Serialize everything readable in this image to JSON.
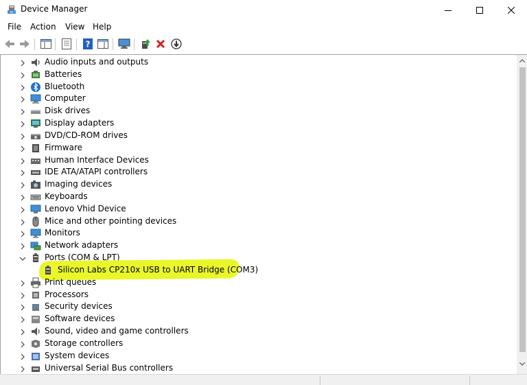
{
  "window": {
    "title": "Device Manager"
  },
  "menu": [
    "File",
    "Action",
    "View",
    "Help"
  ],
  "toolbar": [
    "back-icon",
    "forward-icon",
    "show-hide-console-tree-icon",
    "properties-icon",
    "help-icon",
    "action-pane-icon",
    "scan-hardware-changes-icon",
    "update-driver-icon",
    "uninstall-device-icon",
    "disable-device-icon"
  ],
  "tree": {
    "items": [
      {
        "label": "Audio inputs and outputs",
        "icon": "speaker-icon",
        "expanded": false
      },
      {
        "label": "Batteries",
        "icon": "battery-icon",
        "expanded": false
      },
      {
        "label": "Bluetooth",
        "icon": "bluetooth-icon",
        "expanded": false
      },
      {
        "label": "Computer",
        "icon": "computer-icon",
        "expanded": false
      },
      {
        "label": "Disk drives",
        "icon": "disk-drive-icon",
        "expanded": false
      },
      {
        "label": "Display adapters",
        "icon": "display-adapter-icon",
        "expanded": false
      },
      {
        "label": "DVD/CD-ROM drives",
        "icon": "dvd-drive-icon",
        "expanded": false
      },
      {
        "label": "Firmware",
        "icon": "firmware-icon",
        "expanded": false
      },
      {
        "label": "Human Interface Devices",
        "icon": "hid-icon",
        "expanded": false
      },
      {
        "label": "IDE ATA/ATAPI controllers",
        "icon": "ide-controller-icon",
        "expanded": false
      },
      {
        "label": "Imaging devices",
        "icon": "camera-icon",
        "expanded": false
      },
      {
        "label": "Keyboards",
        "icon": "keyboard-icon",
        "expanded": false
      },
      {
        "label": "Lenovo Vhid Device",
        "icon": "monitor-network-icon",
        "expanded": false
      },
      {
        "label": "Mice and other pointing devices",
        "icon": "mouse-icon",
        "expanded": false
      },
      {
        "label": "Monitors",
        "icon": "monitor-icon",
        "expanded": false
      },
      {
        "label": "Network adapters",
        "icon": "network-adapter-icon",
        "expanded": false
      },
      {
        "label": "Ports (COM & LPT)",
        "icon": "port-icon",
        "expanded": true,
        "children": [
          {
            "label": "Silicon Labs CP210x USB to UART Bridge (COM3)",
            "icon": "port-icon",
            "highlighted": true,
            "highlight_color": "#e9f62a"
          }
        ]
      },
      {
        "label": "Print queues",
        "icon": "printer-icon",
        "expanded": false
      },
      {
        "label": "Processors",
        "icon": "processor-icon",
        "expanded": false
      },
      {
        "label": "Security devices",
        "icon": "security-device-icon",
        "expanded": false
      },
      {
        "label": "Software devices",
        "icon": "software-device-icon",
        "expanded": false
      },
      {
        "label": "Sound, video and game controllers",
        "icon": "speaker-icon",
        "expanded": false
      },
      {
        "label": "Storage controllers",
        "icon": "storage-controller-icon",
        "expanded": false
      },
      {
        "label": "System devices",
        "icon": "system-device-icon",
        "expanded": false
      },
      {
        "label": "Universal Serial Bus controllers",
        "icon": "usb-controller-icon",
        "expanded": false
      }
    ]
  },
  "colors": {
    "highlight": "#e9f62a",
    "selection_fill": "#e9f62a",
    "uninstall_red": "#d42020",
    "help_blue": "#1f5fbf"
  }
}
